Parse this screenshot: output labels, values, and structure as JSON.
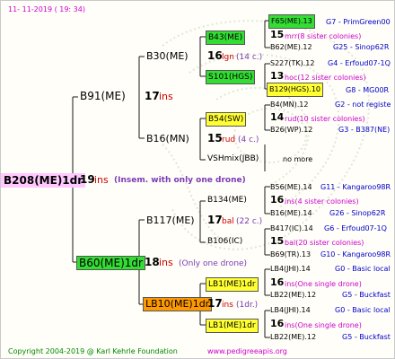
{
  "header": {
    "date": "11-  11-2019  ( 19: 34)"
  },
  "footer": {
    "copyright": "Copyright 2004-2019 @ Karl Kehrle Foundation",
    "url": "www.pedigreeapis.org"
  },
  "colors": {
    "root_bg": "#ffc8ff",
    "green_box": "#33dd33",
    "yellow_box": "#ffff33",
    "orange_box": "#ff9900"
  },
  "root": {
    "label": "B208(ME)1dr",
    "ins": "19",
    "ins_word": "ins",
    "note": "(Insem. with only one drone)"
  },
  "sire": {
    "label": "B91(ME)",
    "ins": "17",
    "ins_word": "ins",
    "top": {
      "label": "B30(ME)",
      "ins": "16",
      "ins_word": "lgn",
      "count": "(14 c.)",
      "a": {
        "label": "B43(ME)",
        "ins": "15",
        "note": "mrr(8 sister colonies)",
        "r1": {
          "left": "F65(ME).13",
          "right": "G7 - PrimGreen00"
        },
        "r2": {
          "left": "B62(ME).12",
          "right": "G25 - Sinop62R"
        }
      },
      "b": {
        "label": "S101(HGS)",
        "ins": "13",
        "note": "hoc(12 sister colonies)",
        "r1": {
          "left": "S227(TK).12",
          "right": "G4 - Erfoud07-1Q"
        },
        "r2": {
          "left": "B129(HGS).10",
          "right": "G8 - MG00R"
        }
      }
    },
    "bottom": {
      "label": "B16(MN)",
      "ins": "15",
      "ins_word": "rud",
      "count": "(4 c.)",
      "a": {
        "label": "B54(SW)",
        "ins": "14",
        "note": "rud(10 sister colonies)",
        "r1": {
          "left": "B4(MN).12",
          "right": "G2 - not registe"
        },
        "r2": {
          "left": "B26(WP).12",
          "right": "G3 - B387(NE)"
        }
      },
      "b": {
        "label": "VSHmix(JBB)",
        "note": "no more"
      }
    }
  },
  "dam": {
    "label": "B60(ME)1dr",
    "ins": "18",
    "ins_word": "ins",
    "note": "(Only one drone)",
    "top": {
      "label": "B117(ME)",
      "ins": "17",
      "ins_word": "bal",
      "count": "(22 c.)",
      "a": {
        "label": "B134(ME)",
        "ins": "16",
        "note": "ins(4 sister colonies)",
        "r1": {
          "left": "B56(ME).14",
          "right": "G11 - Kangaroo98R"
        },
        "r2": {
          "left": "B16(ME).14",
          "right": "G26 - Sinop62R"
        }
      },
      "b": {
        "label": "B106(IC)",
        "ins": "15",
        "note": "bal(20 sister colonies)",
        "r1": {
          "left": "B417(IC).14",
          "right": "G6 - Erfoud07-1Q"
        },
        "r2": {
          "left": "B69(TR).13",
          "right": "G10 - Kangaroo98R"
        }
      }
    },
    "bottom": {
      "label": "LB10(ME)1dr",
      "ins": "17",
      "ins_word": "ins",
      "count": "(1dr.)",
      "a": {
        "label": "LB1(ME)1dr",
        "ins": "16",
        "note": "ins(One single drone)",
        "r1": {
          "left": "LB4(JHI).14",
          "right": "G0 - Basic local"
        },
        "r2": {
          "left": "LB22(ME).12",
          "right": "G5 - Buckfast"
        }
      },
      "b": {
        "label": "LB1(ME)1dr",
        "ins": "16",
        "note": "ins(One single drone)",
        "r1": {
          "left": "LB4(JHI).14",
          "right": "G0 - Basic local"
        },
        "r2": {
          "left": "LB22(ME).12",
          "right": "G5 - Buckfast"
        }
      }
    }
  }
}
